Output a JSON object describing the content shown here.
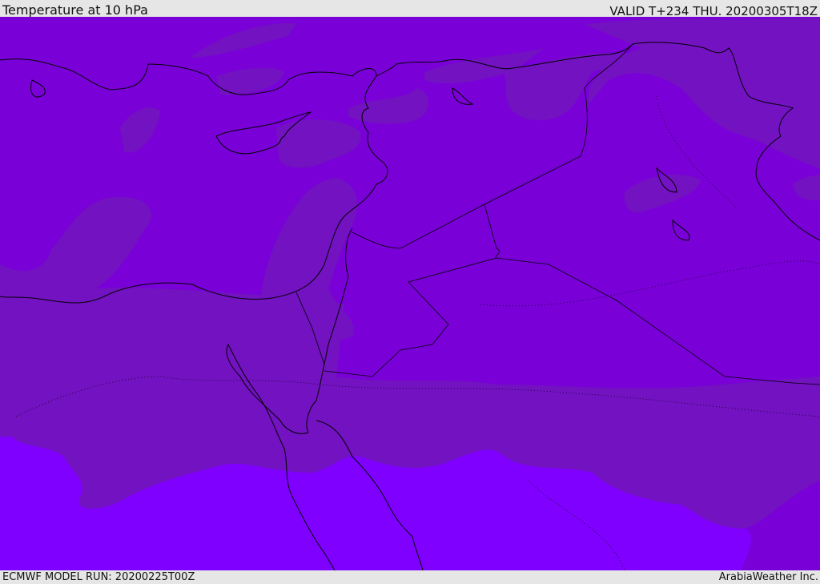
{
  "header": {
    "title": "Temperature at 10 hPa",
    "valid": "VALID T+234 THU. 20200305T18Z"
  },
  "footer": {
    "model_run": "ECMWF MODEL RUN: 20200225T00Z",
    "credit": "ArabiaWeather Inc."
  },
  "map": {
    "variable": "temperature",
    "level": "10 hPa",
    "colors": {
      "base": "#7a00d8",
      "cooler_patch": "#7212c0",
      "warmer_south": "#7f00ff",
      "coastline": "#000000"
    }
  }
}
